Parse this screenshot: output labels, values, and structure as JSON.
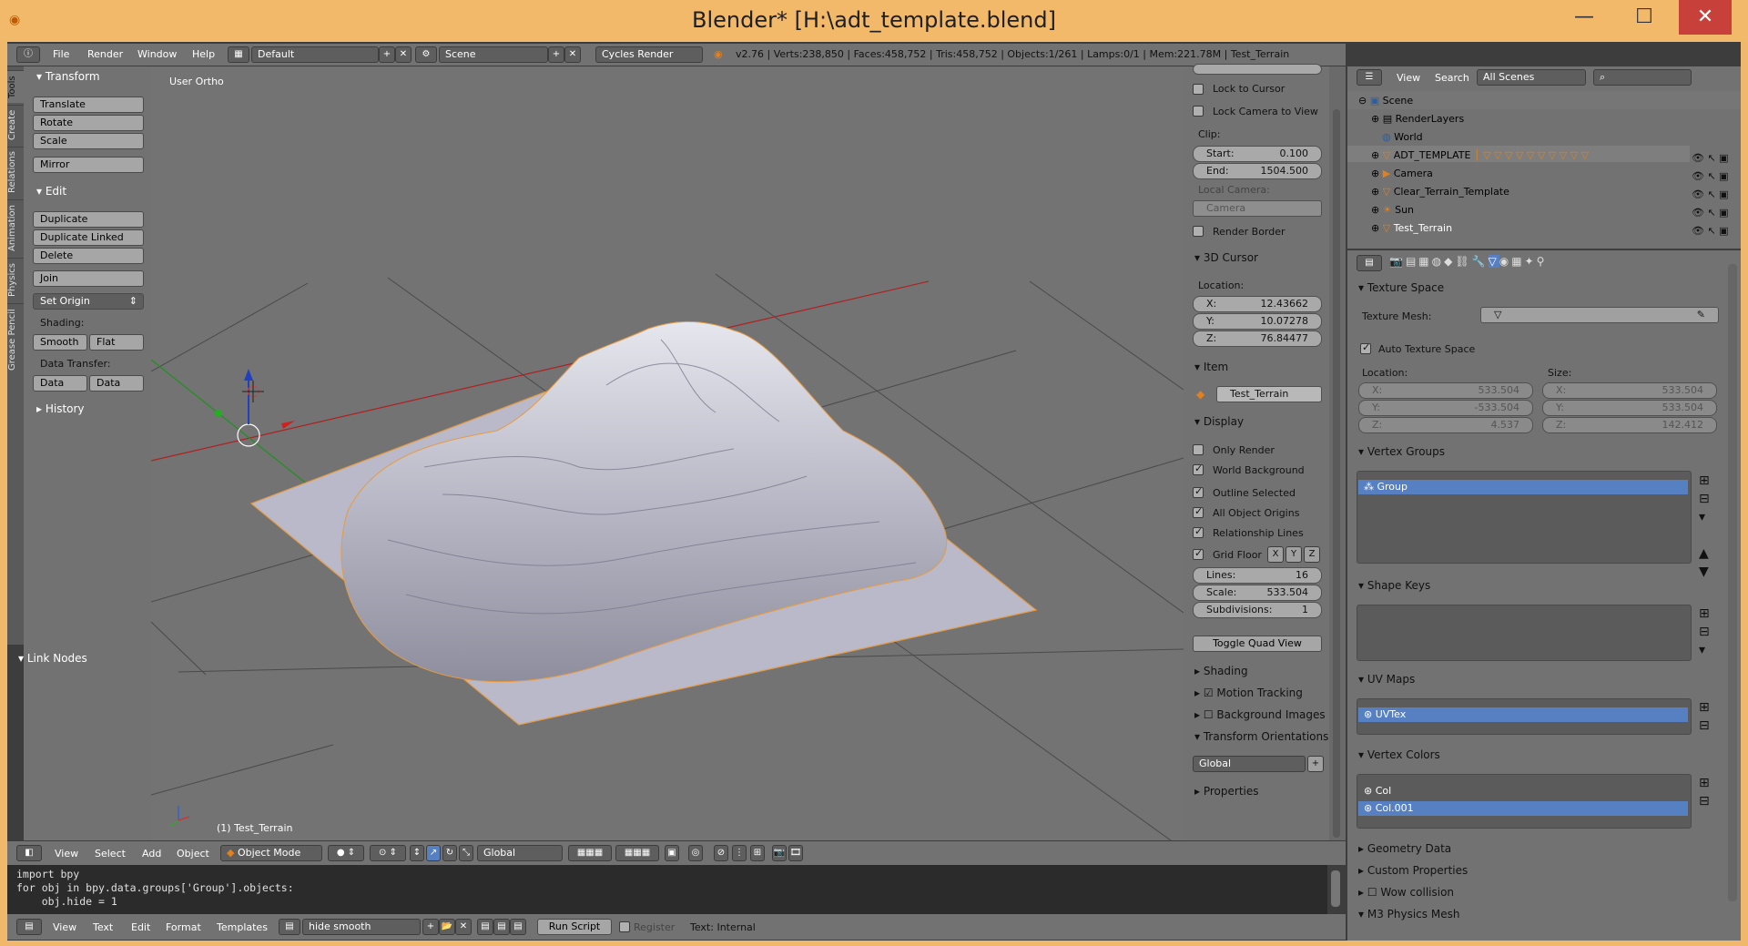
{
  "window": {
    "title": "Blender* [H:\\adt_template.blend]",
    "minimize": "—",
    "maximize": "☐",
    "close": "✕"
  },
  "info": {
    "menu": [
      "File",
      "Render",
      "Window",
      "Help"
    ],
    "layout": "Default",
    "scene": "Scene",
    "engine": "Cycles Render",
    "stats": "v2.76 | Verts:238,850 | Faces:458,752 | Tris:458,752 | Objects:1/261 | Lamps:0/1 | Mem:221.78M | Test_Terrain"
  },
  "tools": {
    "tabs": [
      "Tools",
      "Create",
      "Relations",
      "Animation",
      "Physics",
      "Grease Pencil"
    ],
    "transform": {
      "header": "Transform",
      "buttons": [
        "Translate",
        "Rotate",
        "Scale",
        "Mirror"
      ]
    },
    "edit": {
      "header": "Edit",
      "buttons": [
        "Duplicate",
        "Duplicate Linked",
        "Delete",
        "Join"
      ],
      "set_origin": "Set Origin"
    },
    "shading": {
      "label": "Shading:",
      "smooth": "Smooth",
      "flat": "Flat"
    },
    "data_transfer": {
      "label": "Data Transfer:",
      "data": "Data",
      "data_layout": "Data Layo"
    },
    "history": "History",
    "link_nodes": "Link Nodes"
  },
  "viewport": {
    "view_name": "User Ortho",
    "object_label": "(1) Test_Terrain"
  },
  "npanel": {
    "lock_to_cursor": "Lock to Cursor",
    "lock_camera": "Lock Camera to View",
    "clip_label": "Clip:",
    "clip_start_label": "Start:",
    "clip_start": "0.100",
    "clip_end_label": "End:",
    "clip_end": "1504.500",
    "local_camera_label": "Local Camera:",
    "local_camera": "Camera",
    "render_border": "Render Border",
    "cursor_header": "3D Cursor",
    "location_label": "Location:",
    "cursor": {
      "x_label": "X:",
      "x": "12.43662",
      "y_label": "Y:",
      "y": "10.07278",
      "z_label": "Z:",
      "z": "76.84477"
    },
    "item_header": "Item",
    "item_name": "Test_Terrain",
    "display_header": "Display",
    "display": {
      "only_render": "Only Render",
      "world_background": "World Background",
      "outline_selected": "Outline Selected",
      "all_object_origins": "All Object Origins",
      "relationship_lines": "Relationship Lines",
      "grid_floor": "Grid Floor",
      "axis_x": "X",
      "axis_y": "Y",
      "axis_z": "Z",
      "lines_label": "Lines:",
      "lines": "16",
      "scale_label": "Scale:",
      "scale": "533.504",
      "subdivisions_label": "Subdivisions:",
      "subdivisions": "1"
    },
    "toggle_quad": "Toggle Quad View",
    "shading": "Shading",
    "motion_tracking": "Motion Tracking",
    "background_images": "Background Images",
    "transform_orientations": "Transform Orientations",
    "orientation": "Global",
    "properties": "Properties"
  },
  "outliner": {
    "menu_view": "View",
    "menu_search": "Search",
    "filter": "All Scenes",
    "items": [
      "Scene",
      "RenderLayers",
      "World",
      "ADT_TEMPLATE",
      "Camera",
      "Clear_Terrain_Template",
      "Sun",
      "Test_Terrain"
    ]
  },
  "props": {
    "texture_space": "Texture Space",
    "texture_mesh_label": "Texture Mesh:",
    "auto_texture_space": "Auto Texture Space",
    "location_label": "Location:",
    "size_label": "Size:",
    "loc": {
      "x_label": "X:",
      "x": "533.504",
      "y_label": "Y:",
      "y": "-533.504",
      "z_label": "Z:",
      "z": "4.537"
    },
    "size": {
      "x_label": "X:",
      "x": "533.504",
      "y_label": "Y:",
      "y": "533.504",
      "z_label": "Z:",
      "z": "142.412"
    },
    "vertex_groups": "Vertex Groups",
    "group": "Group",
    "shape_keys": "Shape Keys",
    "uv_maps": "UV Maps",
    "uvtex": "UVTex",
    "vertex_colors": "Vertex Colors",
    "col": "Col",
    "col001": "Col.001",
    "geometry_data": "Geometry Data",
    "custom_properties": "Custom Properties",
    "wow_collision": "Wow collision",
    "m3_physics": "M3 Physics Mesh"
  },
  "view3d_header": {
    "menu": [
      "View",
      "Select",
      "Add",
      "Object"
    ],
    "mode": "Object Mode",
    "orientation": "Global"
  },
  "text_editor": {
    "code": "import bpy\nfor obj in bpy.data.groups['Group'].objects:\n    obj.hide = 1",
    "menu": [
      "View",
      "Text",
      "Edit",
      "Format",
      "Templates"
    ],
    "text_name": "hide smooth",
    "run_script": "Run Script",
    "register": "Register",
    "status": "Text: Internal"
  },
  "colors": {
    "accent": "#5680c2",
    "title_bar": "#f2b96b",
    "close": "#c7413a",
    "x_axis": "#c02020",
    "y_axis": "#20a020"
  }
}
